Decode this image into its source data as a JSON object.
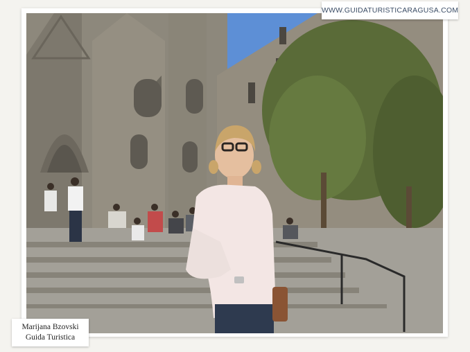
{
  "watermark": {
    "url": "WWW.GUIDATURISTICARAGUSA.COM"
  },
  "caption": {
    "name": "Marijana Bzovski",
    "role": "Guida Turistica"
  },
  "photo": {
    "subject": "woman-in-front-of-gothic-cathedral",
    "colors": {
      "sky": "#5d8fd6",
      "stone": "#8f8a7e",
      "stairs": "#9c9a93",
      "tree": "#5c6b3a",
      "shirt": "#f3e6e4",
      "jeans": "#2e3a4f"
    }
  }
}
